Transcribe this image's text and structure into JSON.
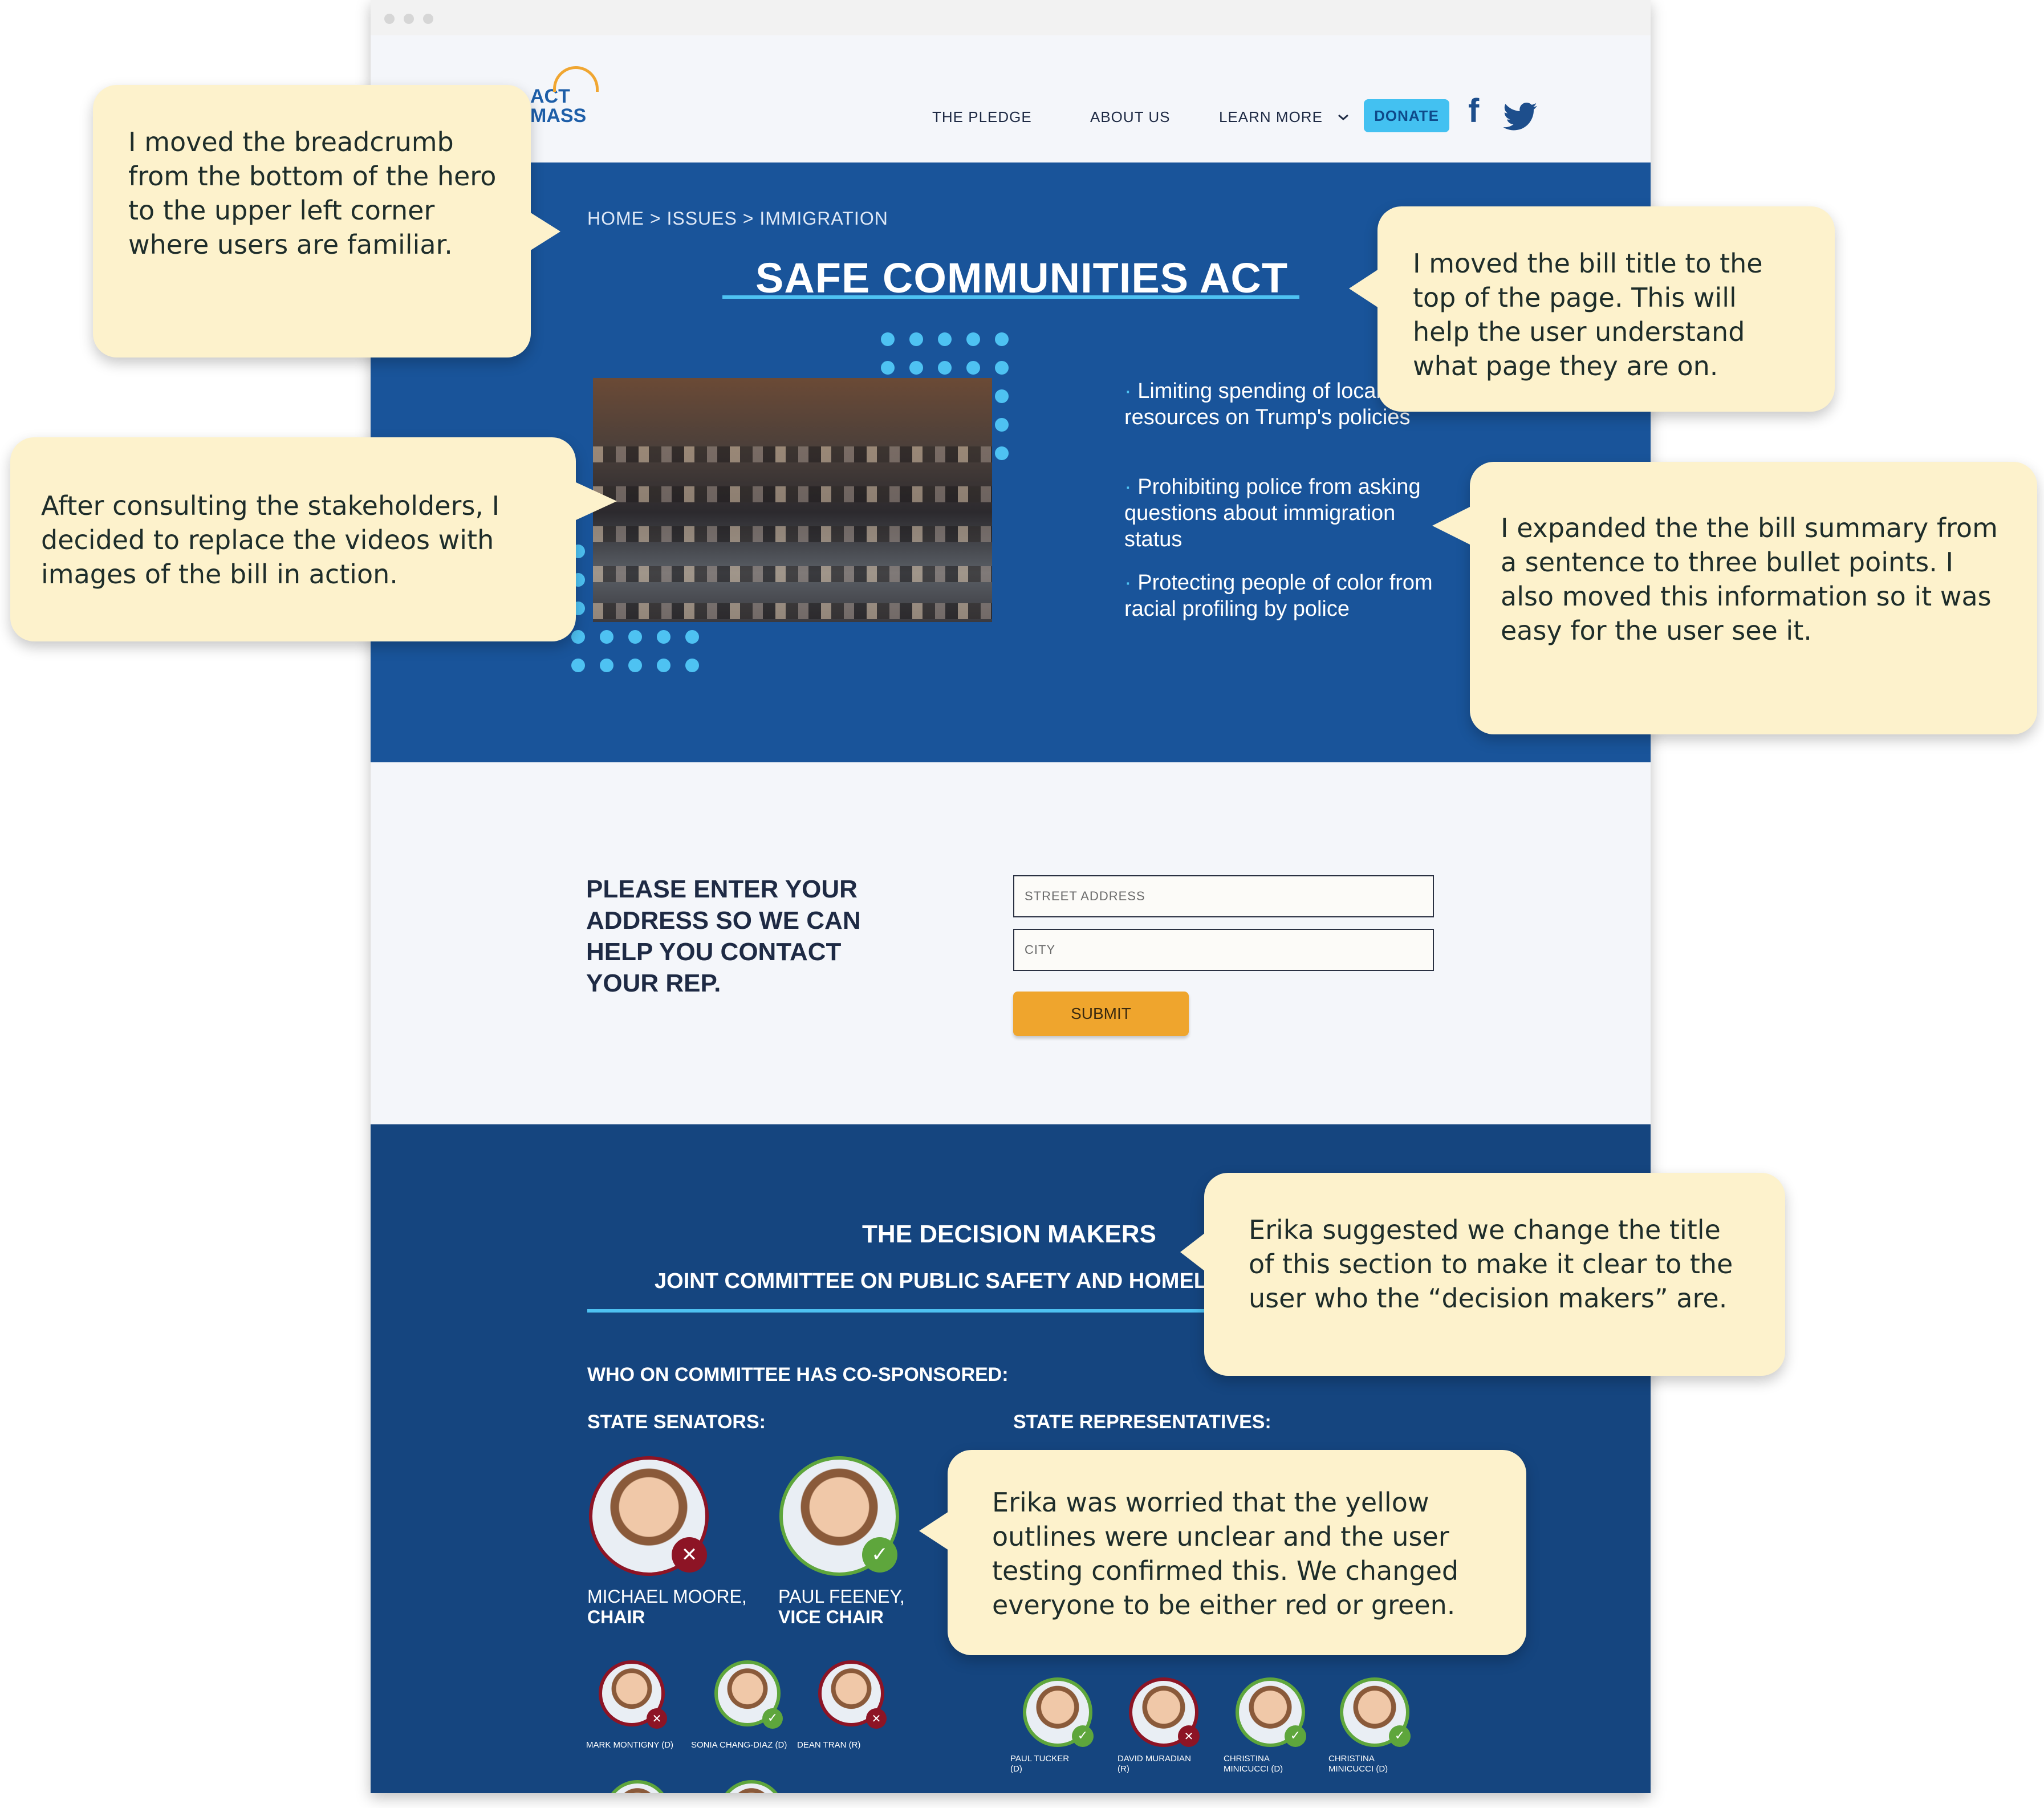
{
  "nav": {
    "logo_line1": "ACT",
    "logo_line2": "MASS",
    "links": [
      "THE PLEDGE",
      "ABOUT US",
      "LEARN MORE"
    ],
    "learn_more_chevron": "chevron-down-icon",
    "donate": "DONATE",
    "social": [
      "facebook-icon",
      "twitter-icon"
    ]
  },
  "hero": {
    "breadcrumb": "HOME > ISSUES > IMMIGRATION",
    "title": "SAFE COMMUNITIES ACT",
    "bullets": [
      "Limiting spending of local police resources on Trump's policies",
      "Prohibiting police from asking questions about immigration status",
      "Protecting people of color from racial profiling by police"
    ]
  },
  "form": {
    "heading": "PLEASE ENTER YOUR ADDRESS SO WE CAN HELP YOU CONTACT YOUR REP.",
    "street_placeholder": "STREET ADDRESS",
    "city_placeholder": "CITY",
    "submit": "SUBMIT"
  },
  "decision_makers": {
    "title": "THE DECISION MAKERS",
    "subtitle": "JOINT COMMITTEE ON PUBLIC SAFETY AND HOMELAND SECURITY",
    "cosponsored_label": "WHO ON COMMITTEE HAS CO-SPONSORED:",
    "senators_label": "STATE SENATORS:",
    "reps_label": "STATE REPRESENTATIVES:",
    "senators_main": [
      {
        "name": "MICHAEL MOORE,",
        "role": "CHAIR",
        "status": "no"
      },
      {
        "name": "PAUL FEENEY,",
        "role": "VICE CHAIR",
        "status": "yes"
      }
    ],
    "senators_small": [
      {
        "name": "MARK MONTIGNY (D)",
        "status": "no"
      },
      {
        "name": "SONIA CHANG-DIAZ (D)",
        "status": "yes"
      },
      {
        "name": "DEAN TRAN (R)",
        "status": "no"
      }
    ],
    "reps_small": [
      {
        "name": "PAUL TUCKER (D)",
        "status": "yes"
      },
      {
        "name": "DAVID MURADIAN (R)",
        "status": "no"
      },
      {
        "name": "CHRISTINA MINICUCCI (D)",
        "status": "yes"
      },
      {
        "name": "CHRISTINA MINICUCCI (D)",
        "status": "yes"
      }
    ]
  },
  "annotations": {
    "breadcrumb": "I moved the breadcrumb from the bottom of the hero to the upper left corner where users are familiar.",
    "title": "I moved the bill title to the top of the page. This will help the user understand what page they are on.",
    "images": "After consulting the stakeholders, I decided to replace the videos with images of the bill in action.",
    "summary": "I expanded the the bill summary from a sentence to three bullet points. I also moved this information so it was easy for the user see it.",
    "section_title": "Erika suggested we change the title of this section to make it clear to the user who the “decision makers” are.",
    "outlines": "Erika was worried that the yellow outlines were unclear and the user testing confirmed this. We changed everyone to be either red or green."
  },
  "colors": {
    "hero_bg": "#19549a",
    "section_bg": "#15457f",
    "accent": "#4ec2f2",
    "donate": "#43c1f1",
    "submit": "#efa52d",
    "note_bg": "#fdf2cc",
    "red_status": "#8d1425",
    "green_status": "#5ea63c"
  }
}
